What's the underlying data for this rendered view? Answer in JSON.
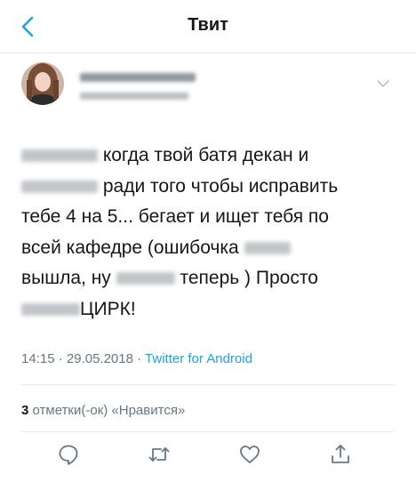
{
  "header": {
    "title": "Твит",
    "back_icon": "chevron-left-icon"
  },
  "tweet": {
    "lines": [
      {
        "blur_before": 86,
        "text": " когда твой батя декан и",
        "blur_after": 0
      },
      {
        "blur_before": 86,
        "text": " ради того чтобы исправить",
        "blur_after": 0
      },
      {
        "blur_before": 0,
        "text": "тебе 4 на 5... бегает и ищет тебя по",
        "blur_after": 0
      },
      {
        "blur_before": 0,
        "text": "всей кафедре (ошибочка ",
        "blur_after": 52
      },
      {
        "blur_before": 0,
        "text": "вышла, ну ",
        "blur_after": 66,
        "text_after": " теперь ) Просто"
      },
      {
        "blur_before": 66,
        "text": "ЦИРК!",
        "blur_after": 0
      }
    ],
    "time": "14:15",
    "separator": " · ",
    "date": "29.05.2018",
    "source": "Twitter for Android"
  },
  "likes": {
    "count": "3",
    "label": " отметки(-ок) «Нравится»"
  },
  "actions": [
    "reply-icon",
    "retweet-icon",
    "like-icon",
    "share-icon"
  ],
  "colors": {
    "accent": "#1da1f2",
    "text": "#14171a",
    "secondary": "#657786",
    "divider": "#e6ecf0"
  }
}
